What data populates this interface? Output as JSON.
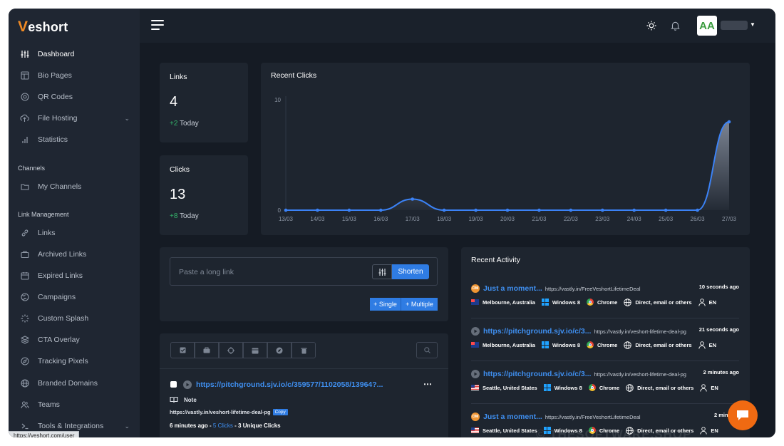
{
  "brand": {
    "logo_letter": "V",
    "logo_rest": "eshort"
  },
  "sidebar": {
    "items": [
      {
        "label": "Dashboard"
      },
      {
        "label": "Bio Pages"
      },
      {
        "label": "QR Codes"
      },
      {
        "label": "File Hosting"
      },
      {
        "label": "Statistics"
      }
    ],
    "channels_title": "Channels",
    "channels_items": [
      {
        "label": "My Channels"
      }
    ],
    "link_title": "Link Management",
    "link_items": [
      {
        "label": "Links"
      },
      {
        "label": "Archived Links"
      },
      {
        "label": "Expired Links"
      },
      {
        "label": "Campaigns"
      },
      {
        "label": "Custom Splash"
      },
      {
        "label": "CTA Overlay"
      },
      {
        "label": "Tracking Pixels"
      },
      {
        "label": "Branded Domains"
      },
      {
        "label": "Teams"
      },
      {
        "label": "Tools & Integrations"
      }
    ]
  },
  "topbar": {
    "avatar_text": "AA"
  },
  "stats": {
    "links": {
      "label": "Links",
      "value": "4",
      "today_plus": "+2",
      "today_label": "Today"
    },
    "clicks": {
      "label": "Clicks",
      "value": "13",
      "today_plus": "+8",
      "today_label": "Today"
    }
  },
  "chart_data": {
    "type": "area",
    "title": "Recent Clicks",
    "categories": [
      "13/03",
      "14/03",
      "15/03",
      "16/03",
      "17/03",
      "18/03",
      "19/03",
      "20/03",
      "21/03",
      "22/03",
      "23/03",
      "24/03",
      "25/03",
      "26/03",
      "27/03"
    ],
    "values": [
      0,
      0,
      0,
      0,
      1,
      0,
      0,
      0,
      0,
      0,
      0,
      0,
      0,
      0,
      8
    ],
    "ylim": [
      0,
      10
    ],
    "yticks": [
      "10",
      "0"
    ],
    "grid": false,
    "color": "#3b82f6"
  },
  "shortener": {
    "placeholder": "Paste a long link",
    "shorten_label": "Shorten",
    "single_label": "+ Single",
    "multiple_label": "+ Multiple"
  },
  "link_item": {
    "title": "https://pitchground.sjv.io/c/359577/1102058/13964?...",
    "note": "Note",
    "short_url": "https://vastly.in/veshort-lifetime-deal-pg",
    "copy_label": "Copy",
    "time": "6 minutes ago",
    "sep1": " - ",
    "clicks": "5 Clicks",
    "sep2": " - ",
    "unique": "3 Unique Clicks"
  },
  "activity": {
    "title": "Recent Activity",
    "items": [
      {
        "badge": "DM",
        "title": "Just a moment...",
        "url": "https://vastly.in/FreeVeshortLifetimeDeal",
        "time": "10 seconds ago",
        "location": "Melbourne, Australia",
        "os": "Windows 8",
        "browser": "Chrome",
        "referrer": "Direct, email or others",
        "lang": "EN"
      },
      {
        "badge": "",
        "title": "https://pitchground.sjv.io/c/3...",
        "url": "https://vastly.in/veshort-lifetime-deal-pg",
        "time": "21 seconds ago",
        "location": "Melbourne, Australia",
        "os": "Windows 8",
        "browser": "Chrome",
        "referrer": "Direct, email or others",
        "lang": "EN"
      },
      {
        "badge": "",
        "title": "https://pitchground.sjv.io/c/3...",
        "url": "https://vastly.in/veshort-lifetime-deal-pg",
        "time": "2 minutes ago",
        "location": "Seattle, United States",
        "os": "Windows 8",
        "browser": "Chrome",
        "referrer": "Direct, email or others",
        "lang": "EN"
      },
      {
        "badge": "DM",
        "title": "Just a moment...",
        "url": "https://vastly.in/FreeVeshortLifetimeDeal",
        "time": "2 minutes",
        "location": "Seattle, United States",
        "os": "Windows 8",
        "browser": "Chrome",
        "referrer": "Direct, email or others",
        "lang": "EN"
      }
    ]
  },
  "statusbar": {
    "url": "https://veshort.com/user"
  },
  "watermark": "© THESOFTWARE.SHOP"
}
